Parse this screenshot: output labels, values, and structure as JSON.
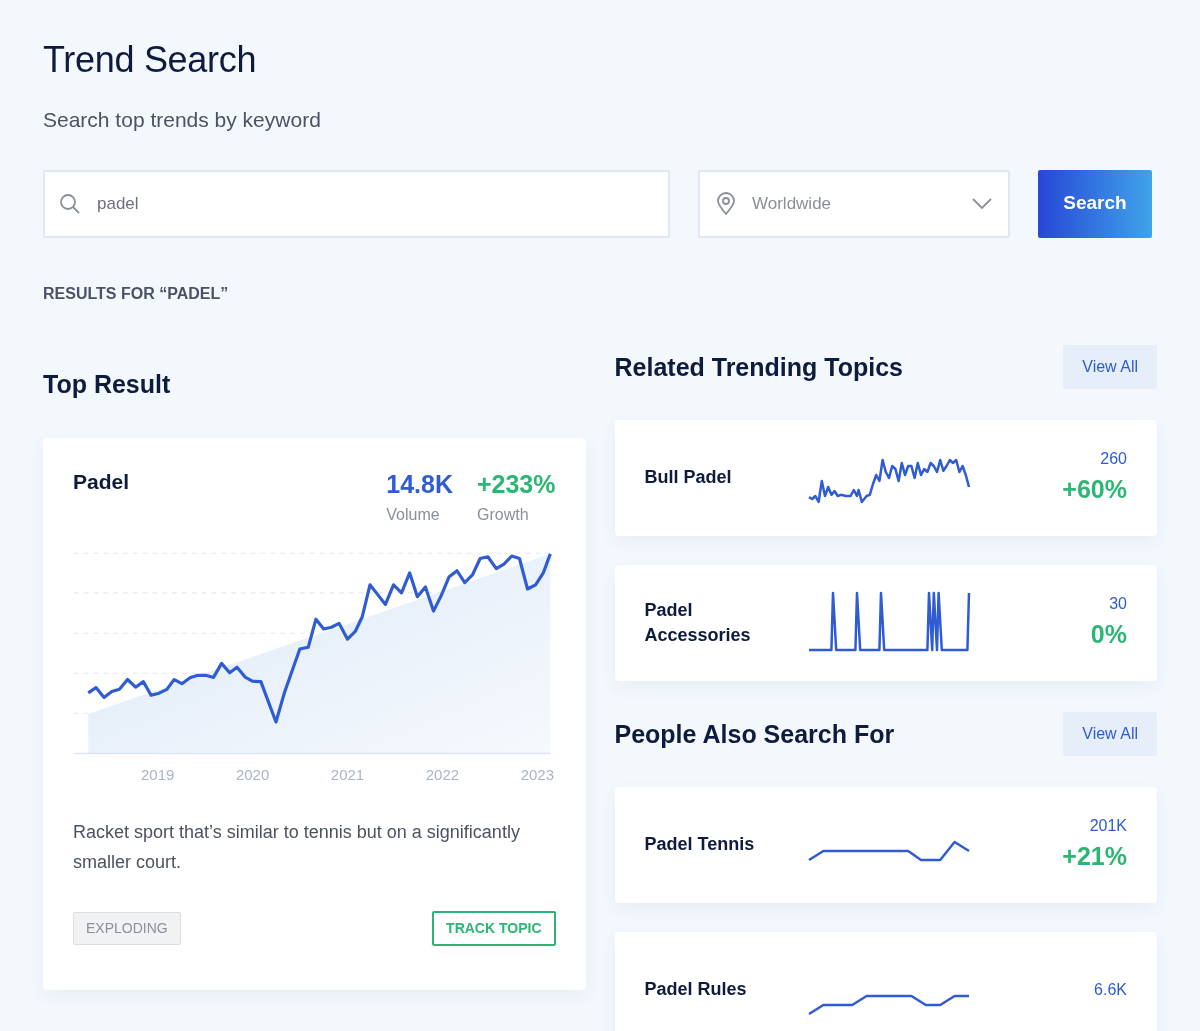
{
  "title": "Trend Search",
  "subtitle": "Search top trends by keyword",
  "search": {
    "value": "padel"
  },
  "location": {
    "value": "Worldwide"
  },
  "search_button": "Search",
  "results_label": "RESULTS FOR “PADEL”",
  "top_result": {
    "heading": "Top Result",
    "name": "Padel",
    "volume": "14.8K",
    "volume_label": "Volume",
    "growth": "+233%",
    "growth_label": "Growth",
    "chart_x_labels": [
      "2019",
      "2020",
      "2021",
      "2022",
      "2023"
    ],
    "description": "Racket sport that’s similar to tennis but on a significantly smaller court.",
    "status_tag": "EXPLODING",
    "track_button": "TRACK TOPIC"
  },
  "related": {
    "heading": "Related Trending Topics",
    "view_all": "View All",
    "items": [
      {
        "name": "Bull Padel",
        "volume": "260",
        "growth": "+60%"
      },
      {
        "name": "Padel Accessories",
        "volume": "30",
        "growth": "0%"
      }
    ]
  },
  "also_search": {
    "heading": "People Also Search For",
    "view_all": "View All",
    "items": [
      {
        "name": "Padel Tennis",
        "volume": "201K",
        "growth": "+21%"
      },
      {
        "name": "Padel Rules",
        "volume": "6.6K"
      }
    ]
  }
}
